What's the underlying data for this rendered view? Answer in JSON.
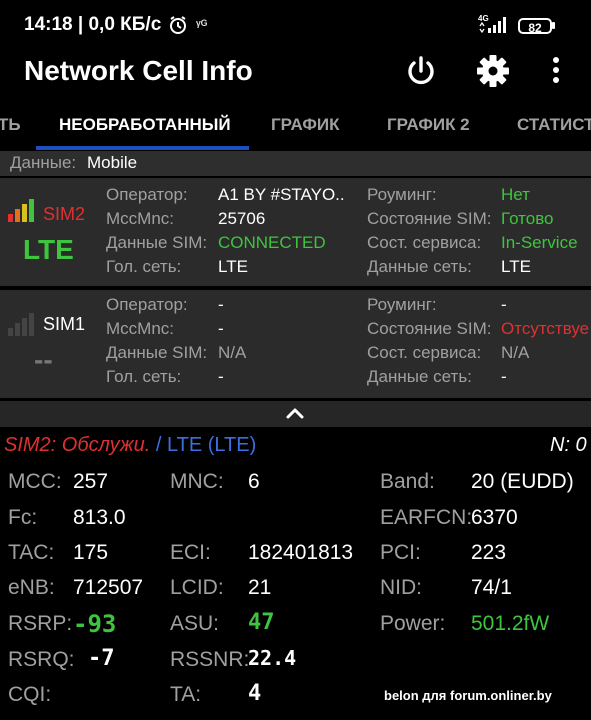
{
  "status_bar": {
    "time_speed": "14:18 | 0,0 КБ/с",
    "network_badge": "4G",
    "battery": "82"
  },
  "app_bar": {
    "title": "Network Cell Info"
  },
  "tabs": [
    {
      "label": "ТЬ"
    },
    {
      "label": "НЕОБРАБОТАННЫЙ"
    },
    {
      "label": "ГРАФИК"
    },
    {
      "label": "ГРАФИК 2"
    },
    {
      "label": "СТАТИСТ"
    }
  ],
  "data_line": {
    "key": "Данные:",
    "value": "Mobile"
  },
  "sim2": {
    "label": "SIM2",
    "tech": "LTE",
    "left": [
      {
        "key": "Оператор:",
        "value": "A1 BY #STAYO.."
      },
      {
        "key": "MccMnc:",
        "value": "25706"
      },
      {
        "key": "Данные SIM:",
        "value": "CONNECTED"
      },
      {
        "key": "Гол. сеть:",
        "value": "LTE"
      }
    ],
    "right": [
      {
        "key": "Роуминг:",
        "value": "Нет"
      },
      {
        "key": "Состояние SIM:",
        "value": "Готово"
      },
      {
        "key": "Сост. сервиса:",
        "value": "In-Service"
      },
      {
        "key": "Данные сеть:",
        "value": "LTE"
      }
    ]
  },
  "sim1": {
    "label": "SIM1",
    "tech": "--",
    "left": [
      {
        "key": "Оператор:",
        "value": "-"
      },
      {
        "key": "MccMnc:",
        "value": "-"
      },
      {
        "key": "Данные SIM:",
        "value": "N/A"
      },
      {
        "key": "Гол. сеть:",
        "value": "-"
      }
    ],
    "right": [
      {
        "key": "Роуминг:",
        "value": "-"
      },
      {
        "key": "Состояние SIM:",
        "value": "Отсутствуе"
      },
      {
        "key": "Сост. сервиса:",
        "value": "N/A"
      },
      {
        "key": "Данные сеть:",
        "value": "-"
      }
    ]
  },
  "summary": {
    "sim_status": "SIM2: Обслужи.",
    "separator": " / ",
    "tech": "LTE (LTE)",
    "n_count": "N: 0"
  },
  "details": {
    "mcc": {
      "key": "MCC:",
      "value": "257"
    },
    "mnc": {
      "key": "MNC:",
      "value": "6"
    },
    "band": {
      "key": "Band:",
      "value": "20 (EUDD)"
    },
    "fc": {
      "key": "Fc:",
      "value": "813.0"
    },
    "earfcn": {
      "key": "EARFCN:",
      "value": "6370"
    },
    "tac": {
      "key": "TAC:",
      "value": "175"
    },
    "eci": {
      "key": "ECI:",
      "value": "182401813"
    },
    "pci": {
      "key": "PCI:",
      "value": "223"
    },
    "enb": {
      "key": "eNB:",
      "value": "712507"
    },
    "lcid": {
      "key": "LCID:",
      "value": "21"
    },
    "nid": {
      "key": "NID:",
      "value": "74/1"
    },
    "rsrp": {
      "key": "RSRP:",
      "value": "-93"
    },
    "asu": {
      "key": "ASU:",
      "value": "47"
    },
    "power": {
      "key": "Power:",
      "value": "501.2fW"
    },
    "rsrq": {
      "key": "RSRQ:",
      "value": "-7"
    },
    "rssnr": {
      "key": "RSSNR:",
      "value": "22.4"
    },
    "cqi": {
      "key": "CQI:",
      "value": ""
    },
    "ta": {
      "key": "TA:",
      "value": "4"
    }
  },
  "watermark": "belon для forum.onliner.by",
  "colors": {
    "accent": "#1e4fbf",
    "green": "#3fc43f",
    "red": "#e03030",
    "blue": "#3d6fe0",
    "panel": "#2b2b2b",
    "muted": "#a0a0a0"
  }
}
